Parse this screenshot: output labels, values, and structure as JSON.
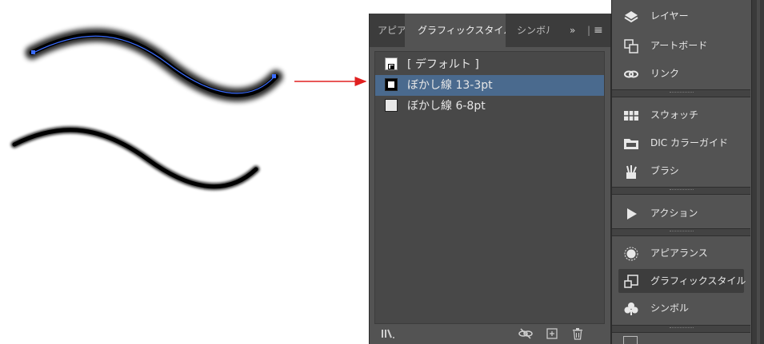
{
  "graphic_styles_panel": {
    "tabs": {
      "appearance": "アピアランス",
      "graphic_styles": "グラフィックスタイル",
      "symbols": "シンボル",
      "overflow": "»",
      "separator": "|",
      "menu": "≡"
    },
    "items": [
      {
        "label": "[ デフォルト ]",
        "selected": false
      },
      {
        "label": "ぼかし線 13-3pt",
        "selected": true
      },
      {
        "label": "ぼかし線 6-8pt",
        "selected": false
      }
    ],
    "footer_icons": [
      "library-icon",
      "break-link-icon",
      "new-style-icon",
      "delete-icon"
    ]
  },
  "dock": {
    "items": [
      {
        "label": "レイヤー",
        "icon": "layers-icon",
        "active": false
      },
      {
        "label": "アートボード",
        "icon": "artboards-icon",
        "active": false
      },
      {
        "label": "リンク",
        "icon": "links-icon",
        "active": false
      },
      {
        "label": "スウォッチ",
        "icon": "swatches-icon",
        "active": false
      },
      {
        "label": "DIC カラーガイド",
        "icon": "dic-color-guide-icon",
        "active": false
      },
      {
        "label": "ブラシ",
        "icon": "brushes-icon",
        "active": false
      },
      {
        "label": "アクション",
        "icon": "actions-icon",
        "active": false
      },
      {
        "label": "アピアランス",
        "icon": "appearance-icon",
        "active": false
      },
      {
        "label": "グラフィックスタイル",
        "icon": "graphic-styles-icon",
        "active": true
      },
      {
        "label": "シンボル",
        "icon": "symbols-icon",
        "active": false
      }
    ]
  },
  "colors": {
    "panel_bg": "#535353",
    "selection": "#4a6a8e",
    "arrow": "#e02020",
    "path_highlight": "#3b6dff"
  }
}
